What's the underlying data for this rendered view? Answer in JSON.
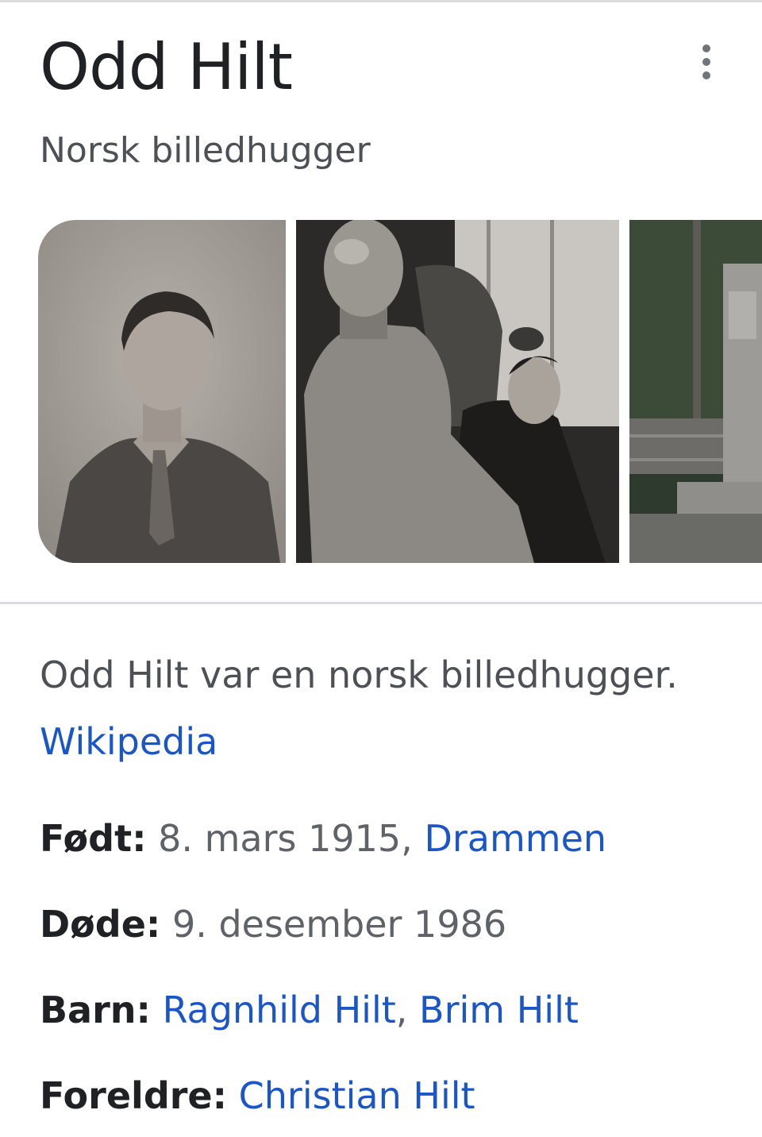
{
  "header": {
    "title": "Odd Hilt",
    "subtitle": "Norsk billedhugger"
  },
  "images": [
    {
      "name": "portrait photo"
    },
    {
      "name": "sculptor with statue photo"
    },
    {
      "name": "monument photo"
    }
  ],
  "description": {
    "text": "Odd Hilt var en norsk billedhugger.",
    "source_link": "Wikipedia"
  },
  "facts": {
    "born": {
      "label": "Født:",
      "value": "8. mars 1915,",
      "link": "Drammen"
    },
    "died": {
      "label": "Døde:",
      "value": "9. desember 1986"
    },
    "children": {
      "label": "Barn:",
      "links": [
        "Ragnhild Hilt",
        "Brim Hilt"
      ],
      "separator": ","
    },
    "parents": {
      "label": "Foreldre:",
      "link": "Christian Hilt"
    }
  },
  "colors": {
    "link": "#1a56c7",
    "text": "#202124",
    "secondary": "#5f6368"
  },
  "icons": {
    "menu": "more-vert-icon"
  }
}
